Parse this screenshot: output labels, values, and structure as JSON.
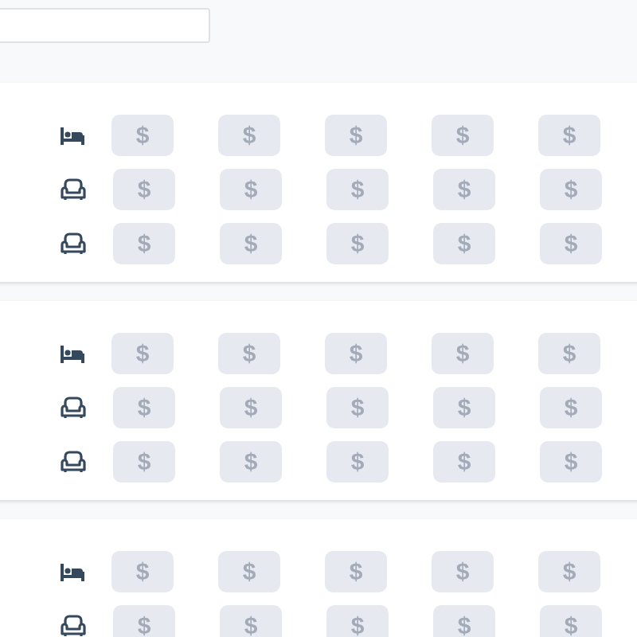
{
  "search": {
    "kind": "field"
  },
  "cards": [
    {
      "rows": [
        {
          "kind": "bed",
          "prices": [
            "$",
            "$",
            "$",
            "$",
            "$"
          ]
        },
        {
          "kind": "sofa",
          "prices": [
            "$",
            "$",
            "$",
            "$",
            "$"
          ]
        },
        {
          "kind": "sofa",
          "prices": [
            "$",
            "$",
            "$",
            "$",
            "$"
          ]
        }
      ]
    },
    {
      "rows": [
        {
          "kind": "bed",
          "prices": [
            "$",
            "$",
            "$",
            "$",
            "$"
          ]
        },
        {
          "kind": "sofa",
          "prices": [
            "$",
            "$",
            "$",
            "$",
            "$"
          ]
        },
        {
          "kind": "sofa",
          "prices": [
            "$",
            "$",
            "$",
            "$",
            "$"
          ]
        }
      ]
    },
    {
      "rows": [
        {
          "kind": "bed",
          "prices": [
            "$",
            "$",
            "$",
            "$",
            "$"
          ]
        },
        {
          "kind": "sofa",
          "prices": [
            "$",
            "$",
            "$",
            "$",
            "$"
          ]
        }
      ]
    }
  ]
}
